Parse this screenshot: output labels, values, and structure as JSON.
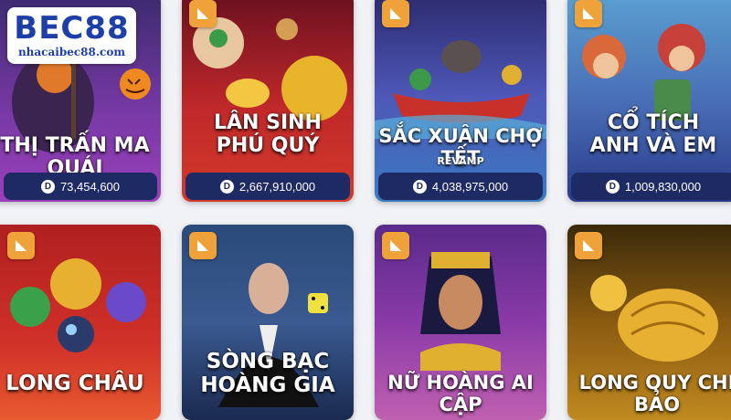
{
  "logo": {
    "brand": "BEC88",
    "site": "nhacaibec88.com"
  },
  "games": [
    {
      "title_lines": [
        "THỊ TRẤN MA QUÁI"
      ],
      "amount": "73,454,600"
    },
    {
      "title_lines": [
        "LÂN SINH",
        "PHÚ QUÝ"
      ],
      "amount": "2,667,910,000"
    },
    {
      "title_lines": [
        "SẮC XUÂN CHỢ TẾT"
      ],
      "subtitle": "REVAMP",
      "amount": "4,038,975,000"
    },
    {
      "title_lines": [
        "CỔ TÍCH",
        "ANH VÀ EM"
      ],
      "amount": "1,009,830,000"
    },
    {
      "title_lines": [
        "LONG CHÂU"
      ]
    },
    {
      "title_lines": [
        "SÒNG BẠC",
        "HOÀNG GIA"
      ]
    },
    {
      "title_lines": [
        "NỮ HOÀNG AI CẬP"
      ]
    },
    {
      "title_lines": [
        "LONG QUY CHI BẢO"
      ]
    }
  ],
  "coin_symbol": "D",
  "badge_icon": "provider-play-icon",
  "colors": {
    "pill": "#1e2a63",
    "badge": "#f0a23a",
    "brand": "#1f3fa8"
  }
}
